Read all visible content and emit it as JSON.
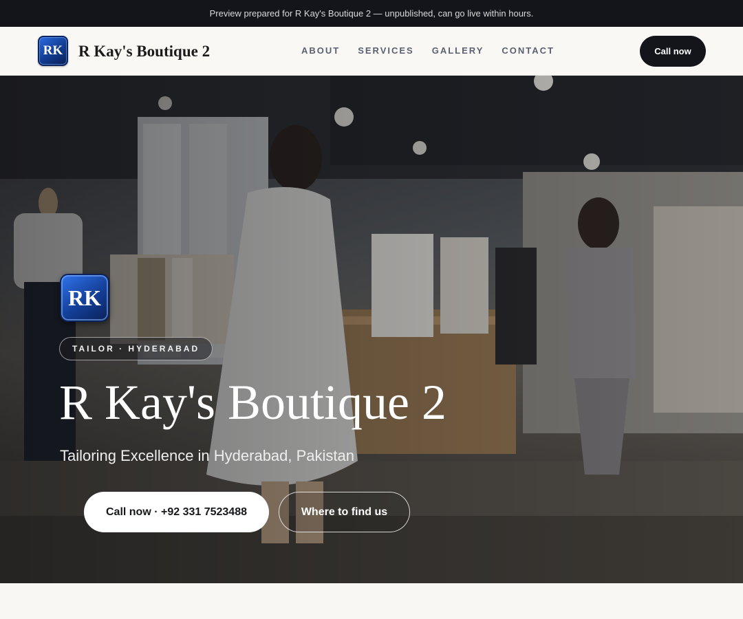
{
  "preview_banner": "Preview prepared for R Kay's Boutique 2 — unpublished, can go live within hours.",
  "header": {
    "logo_initials": "RK",
    "brand_name": "R Kay's Boutique 2",
    "nav": [
      "ABOUT",
      "SERVICES",
      "GALLERY",
      "CONTACT"
    ],
    "cta_label": "Call now"
  },
  "hero": {
    "badge_initials": "RK",
    "tag": "TAILOR · HYDERABAD",
    "title": "R Kay's Boutique 2",
    "subtitle": "Tailoring Excellence in Hyderabad, Pakistan",
    "primary_button": "Call now · +92 331 7523488",
    "secondary_button": "Where to find us",
    "image_alt": "boutique-interior-photo"
  },
  "colors": {
    "dark": "#14151a",
    "page_bg": "#f8f7f3",
    "badge_blue": "#1a4fb8"
  }
}
